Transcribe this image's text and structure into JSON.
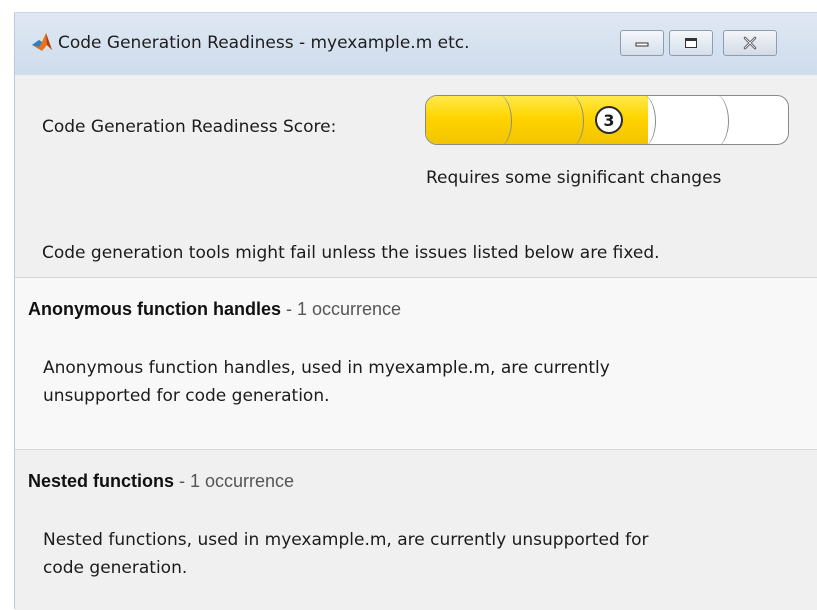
{
  "window": {
    "title": "Code Generation Readiness - myexample.m etc.",
    "icon": "matlab-logo-icon",
    "controls": [
      "minimize-icon",
      "maximize-icon",
      "close-icon"
    ]
  },
  "score": {
    "label": "Code Generation Readiness Score:",
    "value": "3",
    "max": 5,
    "description": "Requires some significant changes",
    "fill_color": "#ffd400"
  },
  "summary": "Code generation tools might fail unless the issues listed below are fixed.",
  "issues": [
    {
      "title": "Anonymous function handles",
      "separator": " - ",
      "count": "1 occurrence",
      "line1": "Anonymous function handles, used in myexample.m, are currently",
      "line2": "unsupported for code generation."
    },
    {
      "title": "Nested functions",
      "separator": " - ",
      "count": "1 occurrence",
      "line1": "Nested functions, used in myexample.m, are currently unsupported for",
      "line2": "code generation."
    }
  ]
}
